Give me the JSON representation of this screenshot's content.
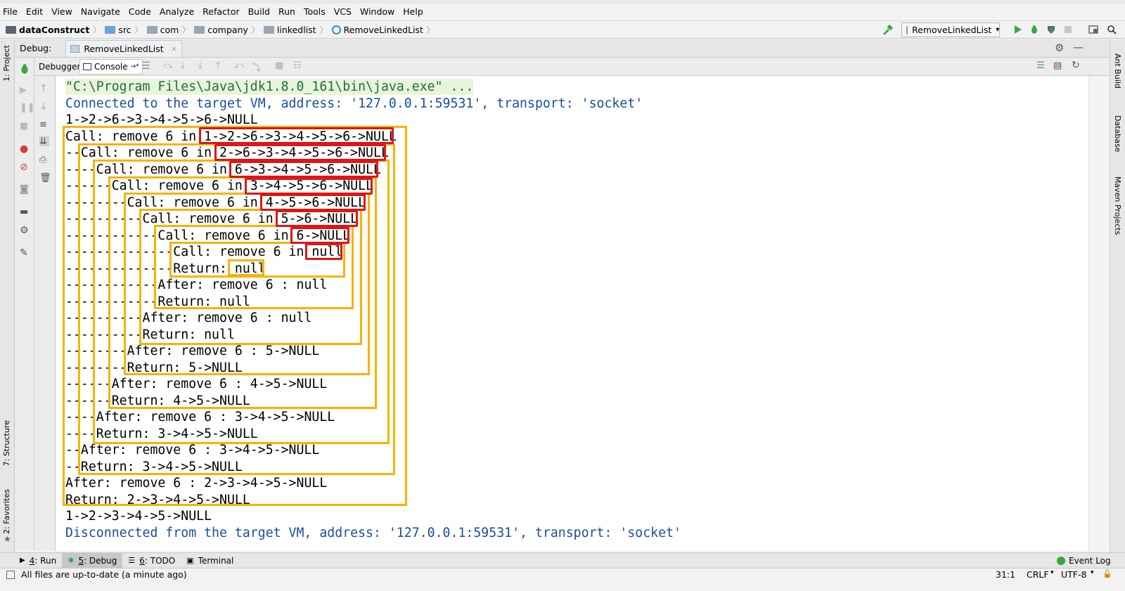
{
  "menu": [
    "File",
    "Edit",
    "View",
    "Navigate",
    "Code",
    "Analyze",
    "Refactor",
    "Build",
    "Run",
    "Tools",
    "VCS",
    "Window",
    "Help"
  ],
  "breadcrumb": {
    "project": "dataConstruct",
    "items": [
      "src",
      "com",
      "company",
      "linkedlist"
    ],
    "file": "RemoveLinkedList"
  },
  "run_config": "RemoveLinkedList",
  "debug": {
    "label": "Debug:",
    "tab": "RemoveLinkedList",
    "tab_close": "×",
    "subtabs": {
      "debugger": "Debugger",
      "console": "Console"
    }
  },
  "left_tabs": {
    "project": "1: Project",
    "structure": "7: Structure",
    "favorites": "2: Favorites"
  },
  "right_tabs": {
    "ant": "Ant Build",
    "database": "Database",
    "maven": "Maven Projects"
  },
  "console_lines": [
    "\"C:\\Program Files\\Java\\jdk1.8.0_161\\bin\\java.exe\" ...",
    "Connected to the target VM, address: '127.0.0.1:59531', transport: 'socket'",
    "1->2->6->3->4->5->6->NULL",
    "Call: remove 6 in 1->2->6->3->4->5->6->NULL",
    "--Call: remove 6 in 2->6->3->4->5->6->NULL",
    "----Call: remove 6 in 6->3->4->5->6->NULL",
    "------Call: remove 6 in 3->4->5->6->NULL",
    "--------Call: remove 6 in 4->5->6->NULL",
    "----------Call: remove 6 in 5->6->NULL",
    "------------Call: remove 6 in 6->NULL",
    "--------------Call: remove 6 in null",
    "--------------Return: null",
    "------------After: remove 6 : null",
    "------------Return: null",
    "----------After: remove 6 : null",
    "----------Return: null",
    "--------After: remove 6 : 5->NULL",
    "--------Return: 5->NULL",
    "------After: remove 6 : 4->5->NULL",
    "------Return: 4->5->NULL",
    "----After: remove 6 : 3->4->5->NULL",
    "----Return: 3->4->5->NULL",
    "--After: remove 6 : 3->4->5->NULL",
    "--Return: 3->4->5->NULL",
    "After: remove 6 : 2->3->4->5->NULL",
    "Return: 2->3->4->5->NULL",
    "1->2->3->4->5->NULL",
    "Disconnected from the target VM, address: '127.0.0.1:59531', transport: 'socket'"
  ],
  "bottom_tabs": [
    {
      "num": "4",
      "label": ": Run"
    },
    {
      "num": "5",
      "label": ": Debug"
    },
    {
      "num": "6",
      "label": ": TODO"
    },
    {
      "num": "",
      "label": "Terminal"
    }
  ],
  "event_log": "Event Log",
  "status": {
    "message": "All files are up-to-date (a minute ago)",
    "position": "31:1",
    "line_sep": "CRLF",
    "encoding": "UTF-8"
  },
  "colors": {
    "orange_box": "#f6b300",
    "red_box": "#e01515",
    "console_blue": "#1a4d9e",
    "run_green": "#3aa83a"
  }
}
